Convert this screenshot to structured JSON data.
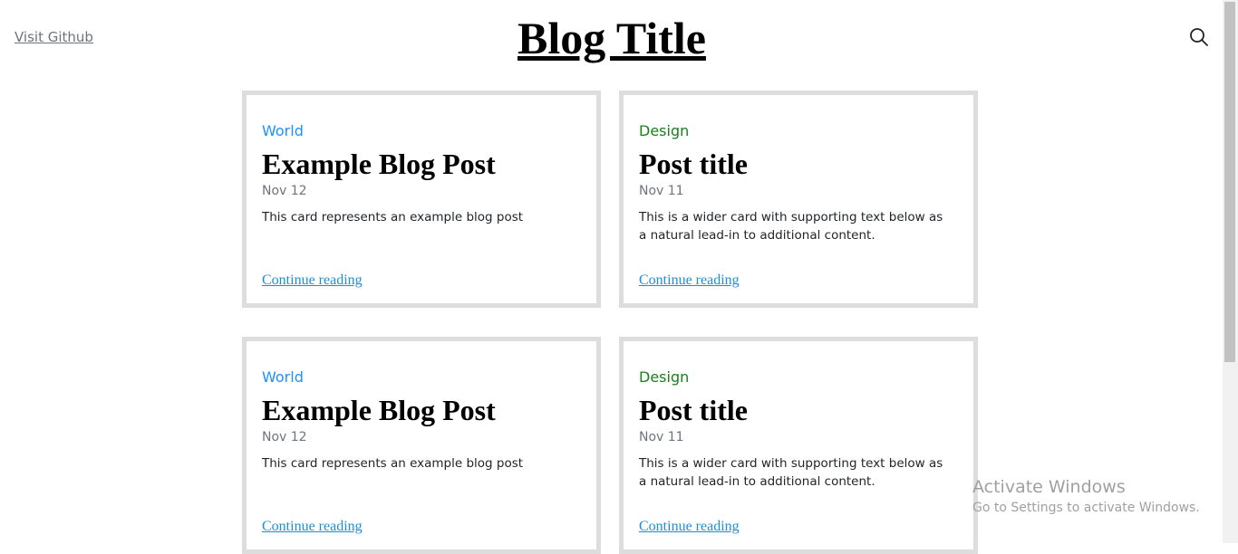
{
  "header": {
    "github_link": "Visit Github",
    "title": "Blog Title",
    "search_icon": "search-icon"
  },
  "posts": [
    {
      "category": "World",
      "title": "Example Blog Post",
      "date": "Nov 12",
      "excerpt": "This card represents an example blog post",
      "link": "Continue reading"
    },
    {
      "category": "Design",
      "title": "Post title",
      "date": "Nov 11",
      "excerpt": "This is a wider card with supporting text below as a natural lead-in to additional content.",
      "link": "Continue reading"
    },
    {
      "category": "World",
      "title": "Example Blog Post",
      "date": "Nov 12",
      "excerpt": "This card represents an example blog post",
      "link": "Continue reading"
    },
    {
      "category": "Design",
      "title": "Post title",
      "date": "Nov 11",
      "excerpt": "This is a wider card with supporting text below as a natural lead-in to additional content.",
      "link": "Continue reading"
    }
  ],
  "colors": {
    "world": "#1e90ff",
    "design": "#1a7f1a",
    "link": "#1a8fd8",
    "card_border": "#dddddd"
  },
  "watermark": {
    "line1": "Activate Windows",
    "line2": "Go to Settings to activate Windows."
  }
}
